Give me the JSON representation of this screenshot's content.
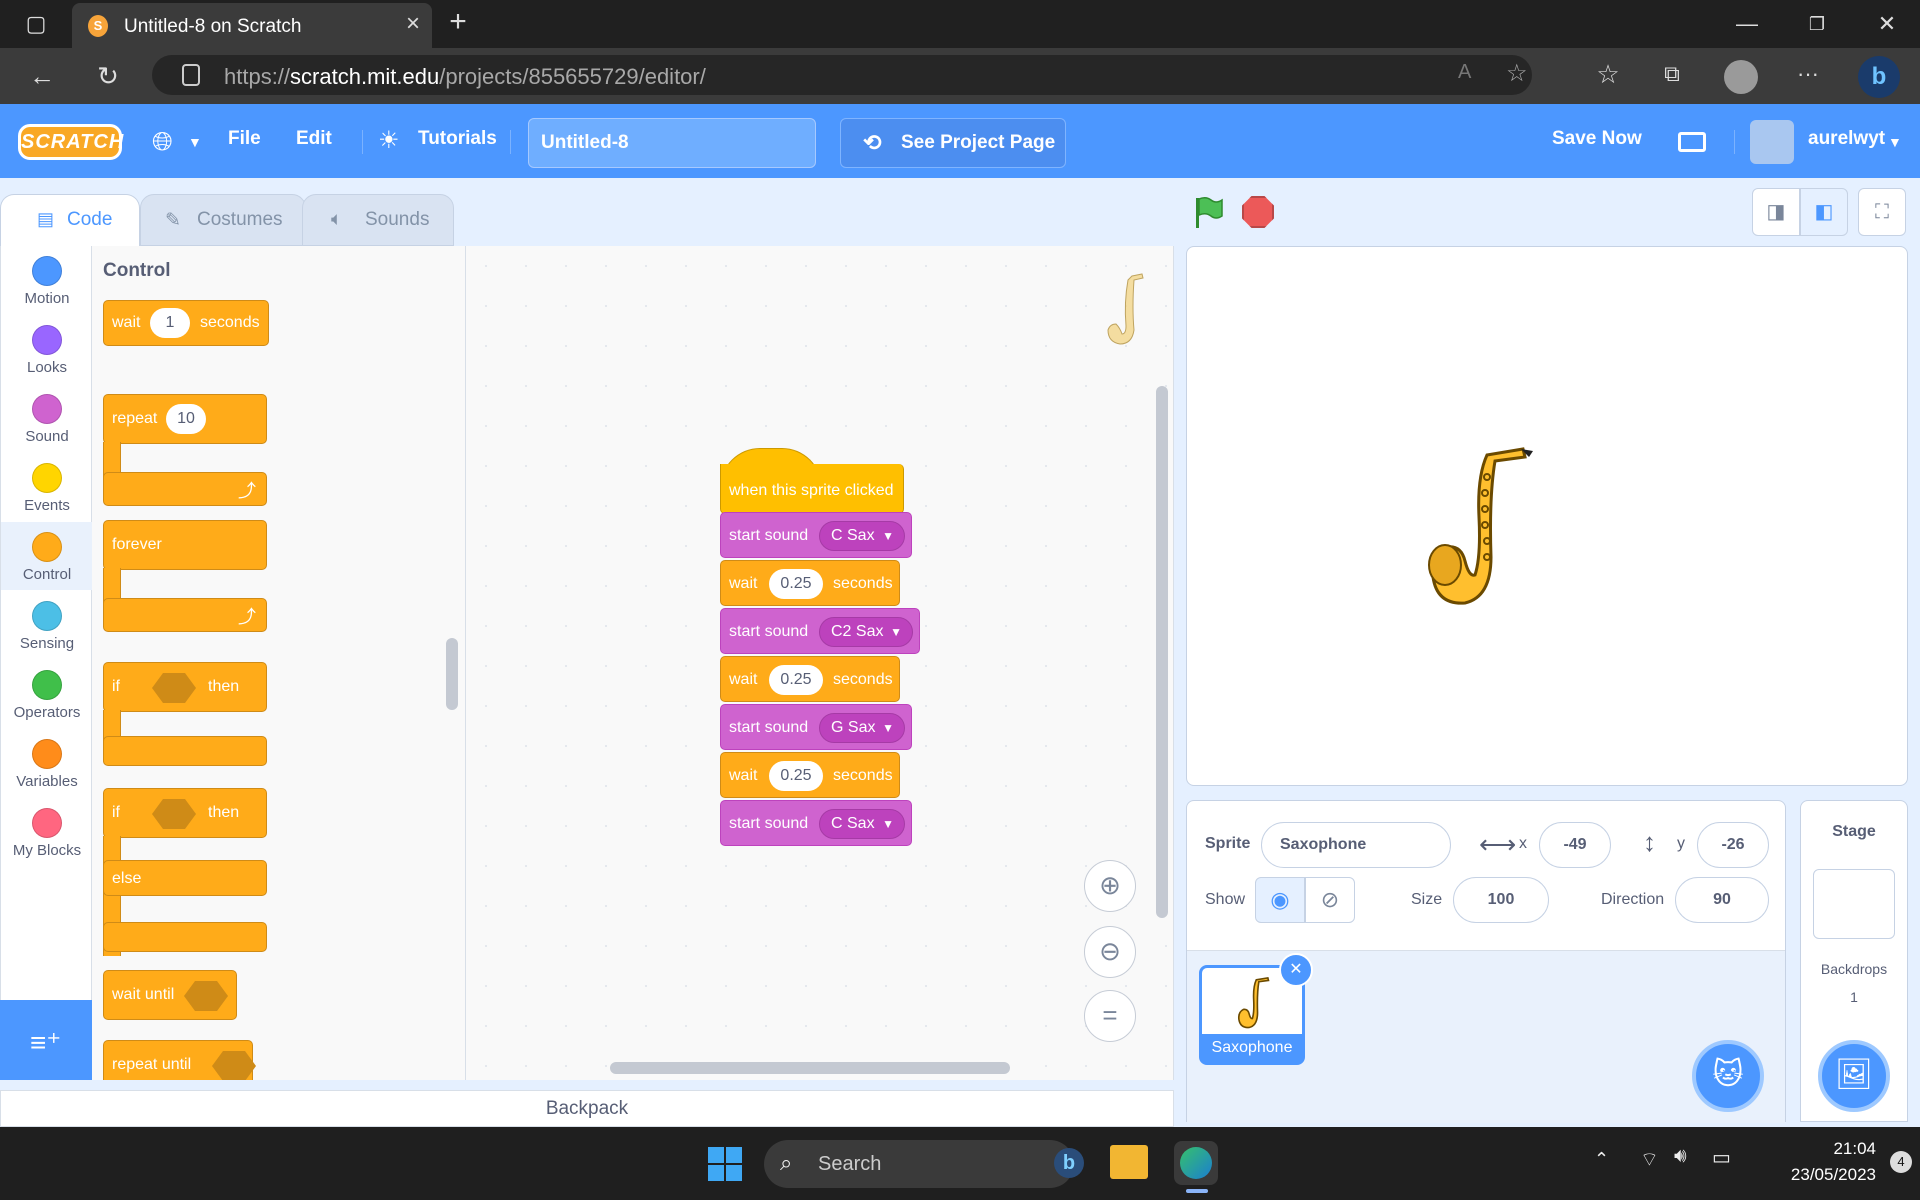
{
  "browser": {
    "tab_title": "Untitled-8 on Scratch",
    "tab_close": "×",
    "new_tab": "+",
    "url_prefix": "https://",
    "url_domain": "scratch.mit.edu",
    "url_path": "/projects/855655729/editor/",
    "window_controls": [
      "—",
      "❐",
      "✕"
    ]
  },
  "menubar": {
    "logo": "SCRATCH",
    "file": "File",
    "edit": "Edit",
    "tutorials": "Tutorials",
    "project_title": "Untitled-8",
    "see_project": "See Project Page",
    "save_now": "Save Now",
    "username": "aurelwyt"
  },
  "editor_tabs": {
    "code": "Code",
    "costumes": "Costumes",
    "sounds": "Sounds"
  },
  "categories": [
    {
      "label": "Motion",
      "color": "#4c97ff"
    },
    {
      "label": "Looks",
      "color": "#9966ff"
    },
    {
      "label": "Sound",
      "color": "#cf63cf"
    },
    {
      "label": "Events",
      "color": "#ffd500"
    },
    {
      "label": "Control",
      "color": "#ffab19"
    },
    {
      "label": "Sensing",
      "color": "#4cbfe6"
    },
    {
      "label": "Operators",
      "color": "#40bf4a"
    },
    {
      "label": "Variables",
      "color": "#ff8c1a"
    },
    {
      "label": "My Blocks",
      "color": "#ff6680"
    }
  ],
  "palette": {
    "heading": "Control",
    "wait": "wait",
    "wait_value": "1",
    "seconds": "seconds",
    "repeat": "repeat",
    "repeat_value": "10",
    "forever": "forever",
    "if": "if",
    "then": "then",
    "else": "else",
    "wait_until": "wait until",
    "repeat_until": "repeat until"
  },
  "script": {
    "hat": "when this sprite clicked",
    "blocks": [
      {
        "type": "sound",
        "label": "start sound",
        "value": "C Sax"
      },
      {
        "type": "wait",
        "label": "wait",
        "value": "0.25",
        "suffix": "seconds"
      },
      {
        "type": "sound",
        "label": "start sound",
        "value": "C2 Sax"
      },
      {
        "type": "wait",
        "label": "wait",
        "value": "0.25",
        "suffix": "seconds"
      },
      {
        "type": "sound",
        "label": "start sound",
        "value": "G Sax"
      },
      {
        "type": "wait",
        "label": "wait",
        "value": "0.25",
        "suffix": "seconds"
      },
      {
        "type": "sound",
        "label": "start sound",
        "value": "C Sax"
      }
    ]
  },
  "backpack": "Backpack",
  "sprite_info": {
    "sprite_label": "Sprite",
    "sprite_name": "Saxophone",
    "x_label": "x",
    "x_value": "-49",
    "y_label": "y",
    "y_value": "-26",
    "show_label": "Show",
    "size_label": "Size",
    "size_value": "100",
    "direction_label": "Direction",
    "direction_value": "90"
  },
  "sprites": [
    {
      "name": "Saxophone"
    }
  ],
  "stage_pane": {
    "title": "Stage",
    "backdrops_label": "Backdrops",
    "backdrops_count": "1"
  },
  "taskbar": {
    "search": "Search",
    "time": "21:04",
    "date": "23/05/2023",
    "notifications": "4"
  }
}
